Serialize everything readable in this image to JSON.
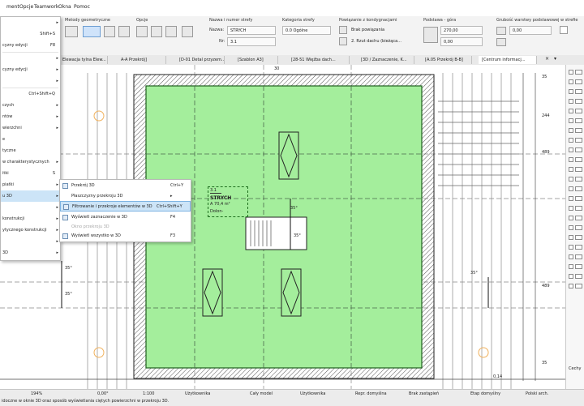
{
  "menubar": {
    "items": [
      "ment",
      "Opcje",
      "Teamwork",
      "Okna",
      "Pomoc"
    ]
  },
  "ribbon": {
    "group_labels": {
      "metoda_geometryczna": "Metody geometryczne",
      "opcje": "Opcje",
      "nazwa_numer": "Nazwa i numer strefy",
      "kategoria": "Kategoria strefy",
      "powiazanie": "Powiązanie z kondygnacjami",
      "podstawa": "Podstawa - góra",
      "grubosc": "Grubość warstwy podstawowej w strefie"
    },
    "field_labels": {
      "nazwa": "Nazwa:",
      "nr": "Nr:"
    },
    "values": {
      "nazwa": "STRYCH",
      "nr": "3.1",
      "kategoria": "0.0 Ogólne",
      "powiazanie_1": "Brak powiązania",
      "powiazanie_2": "2. Rzut dachu (bieżąca...",
      "podstawa": "270,00",
      "gora": "0,00",
      "grubosc": "0,00"
    }
  },
  "tabs": [
    {
      "label": "Elewacja tylna Elew...",
      "active": false
    },
    {
      "label": "A-A Przekrój]",
      "active": false
    },
    {
      "label": "[D-01 Detal przyzem...",
      "active": false
    },
    {
      "label": "[Szablon A3]",
      "active": false
    },
    {
      "label": "[28-51 Więźba dach...",
      "active": false
    },
    {
      "label": "[3D / Zaznaczenie, K...",
      "active": false
    },
    {
      "label": "[A.05 Przekrój B-B]",
      "active": false
    },
    {
      "label": "[Centrum informacj...",
      "active": true
    }
  ],
  "left_menu": {
    "items": [
      {
        "label": "",
        "shortcut": "",
        "arrow": "▸"
      },
      {
        "label": "",
        "shortcut": "Shift+S",
        "arrow": ""
      },
      {
        "label": "cyzny edycji",
        "shortcut": "F8",
        "arrow": ""
      },
      {
        "label": "",
        "shortcut": "",
        "arrow": "▸"
      },
      {
        "label": "cyzny edycji",
        "shortcut": "",
        "arrow": "▸"
      },
      {
        "label": "",
        "shortcut": "",
        "arrow": "▸"
      },
      {
        "label": "",
        "shortcut": "Ctrl+Shift+Q",
        "arrow": ""
      },
      {
        "label": "czych",
        "shortcut": "",
        "arrow": "▸"
      },
      {
        "label": "ntów",
        "shortcut": "",
        "arrow": "▸"
      },
      {
        "label": "wierzchni",
        "shortcut": "",
        "arrow": "▸"
      },
      {
        "label": "e",
        "shortcut": "",
        "arrow": ""
      },
      {
        "label": "tyczne",
        "shortcut": "",
        "arrow": ""
      },
      {
        "label": "w charakterystycznych",
        "shortcut": "",
        "arrow": "▸"
      },
      {
        "label": "itki",
        "shortcut": "S",
        "arrow": ""
      },
      {
        "label": "piatki",
        "shortcut": "",
        "arrow": "▸"
      },
      {
        "label": "u 3D",
        "shortcut": "",
        "arrow": "▸"
      },
      {
        "label": "",
        "shortcut": "",
        "arrow": "▸"
      },
      {
        "label": "konstrukcji",
        "shortcut": "",
        "arrow": "▸"
      },
      {
        "label": "ytycznego konstrukcji",
        "shortcut": "",
        "arrow": "▸"
      },
      {
        "label": "",
        "shortcut": "",
        "arrow": "▸"
      },
      {
        "label": "3D",
        "shortcut": "",
        "arrow": "▸"
      }
    ]
  },
  "submenu": {
    "items": [
      {
        "label": "Przekrój 3D",
        "shortcut": "Ctrl+Y",
        "disabled": false,
        "highlighted": false
      },
      {
        "label": "Płaszczyzny przekroju 3D",
        "shortcut": "",
        "disabled": false,
        "highlighted": false,
        "arrow": "▸"
      },
      {
        "label": "Filtrowanie i przekroje elementów w 3D",
        "shortcut": "Ctrl+Shift+Y",
        "disabled": false,
        "highlighted": true
      },
      {
        "label": "Wyświetl zaznaczenie w 3D",
        "shortcut": "F4",
        "disabled": false,
        "highlighted": false
      },
      {
        "label": "Okno przekroju 3D",
        "shortcut": "",
        "disabled": true,
        "highlighted": false
      },
      {
        "label": "Wyświetl wszystko w 3D",
        "shortcut": "F3",
        "disabled": false,
        "highlighted": false
      }
    ]
  },
  "zone": {
    "number": "3.1",
    "name": "STRYCH",
    "area": "A 70,4 m²",
    "floor": "Dolon-",
    "fill_color": "#a4ee9c"
  },
  "drawing": {
    "dim_top": "30",
    "dim_right": [
      "35",
      "244",
      "489",
      "489",
      "35"
    ],
    "bottom_value": "0,14",
    "stair_labels": [
      "35°",
      "35°"
    ],
    "side_labels": [
      "35°",
      "35°",
      "35°"
    ]
  },
  "statusbar": {
    "items": [
      "194%",
      "0,00°",
      "1:100",
      "Użytkownika",
      "Cały model",
      "Użytkownika",
      "Repr. domyślna",
      "Brak zastąpień",
      "Etap domyślny",
      "Polski arch."
    ],
    "hint": "idoczne w oknie 3D oraz sposób wyświetlania ciętych powierzchni w przekroju 3D."
  },
  "navigator": {
    "title": "Cechy"
  },
  "colors": {
    "zone_green": "#a4ee9c",
    "menu_highlight": "#cce4f7",
    "wall_hatch": "#555555"
  }
}
